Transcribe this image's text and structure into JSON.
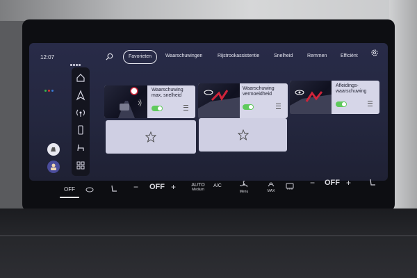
{
  "status": {
    "time": "12:07"
  },
  "nav": {
    "tabs": [
      {
        "label": "Favorieten",
        "active": true
      },
      {
        "label": "Waarschuwingen"
      },
      {
        "label": "Rijstrookassistentie"
      },
      {
        "label": "Snelheid"
      },
      {
        "label": "Remmen"
      },
      {
        "label": "Efficiënt"
      }
    ]
  },
  "sidebar": {
    "icons": [
      "home-icon",
      "navigation-icon",
      "radio-icon",
      "phone-icon",
      "seat-icon",
      "apps-icon"
    ]
  },
  "cards": [
    {
      "title_line1": "Waarschuwing",
      "title_line2": "max. snelheid",
      "enabled": true
    },
    {
      "title_line1": "Waarschuwing",
      "title_line2": "vermoeidheid",
      "enabled": true
    },
    {
      "title_line1": "Afleidings-",
      "title_line2": "waarschuwing",
      "enabled": true
    }
  ],
  "climate": {
    "left_fan": "OFF",
    "left_temp": "OFF",
    "auto_label": "AUTO",
    "auto_sub": "Medium",
    "ac_label": "A/C",
    "menu_label": "Menu",
    "max_label": "MAX",
    "right_temp": "OFF"
  },
  "colors": {
    "toggle_on": "#5fca5c",
    "accent_red": "#d0243a",
    "card_bg": "#d6d6e8"
  }
}
